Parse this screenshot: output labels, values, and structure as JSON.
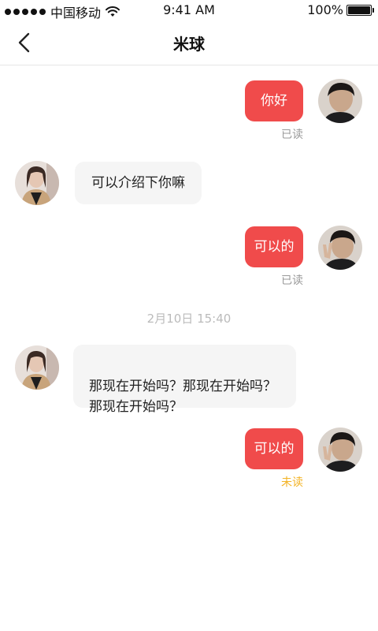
{
  "status_bar": {
    "carrier": "中国移动",
    "time": "9:41 AM",
    "battery": "100%",
    "battery_level": 1.0
  },
  "nav": {
    "title": "米球",
    "back_icon": "chevron-left-icon"
  },
  "messages": [
    {
      "side": "me",
      "text": "你好",
      "receipt": "已读"
    },
    {
      "side": "them",
      "text": "可以介绍下你嘛"
    },
    {
      "side": "me",
      "text": "可以的",
      "receipt": "已读"
    },
    {
      "side": "them",
      "text": "那现在开始吗？那现在开始吗？\n那现在开始吗？"
    },
    {
      "side": "me",
      "text": "可以的",
      "receipt": "未读"
    }
  ],
  "timestamp": "2月10日 15:40",
  "colors": {
    "my_bubble": "#f04b4b",
    "their_bubble": "#f5f5f5",
    "read_receipt": "#999999",
    "unread_receipt": "#f3b325",
    "timestamp": "#bbbbbb"
  }
}
